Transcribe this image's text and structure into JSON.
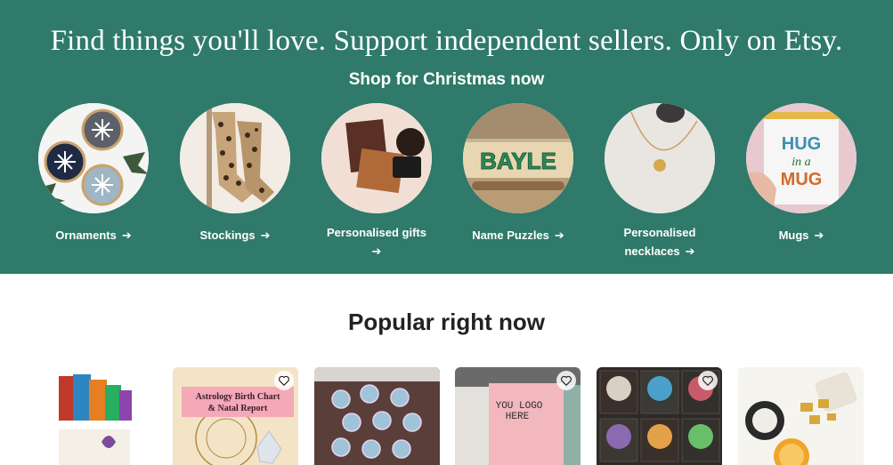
{
  "hero": {
    "title": "Find things you'll love. Support independent sellers. Only on Etsy.",
    "subtitle": "Shop for Christmas now",
    "background_color": "#2f7a6a",
    "categories": [
      {
        "label": "Ornaments",
        "image": "embroidered snowflake hoop ornaments"
      },
      {
        "label": "Stockings",
        "image": "leopard print stockings"
      },
      {
        "label": "Personalised gifts",
        "image": "leather notebook and coaster"
      },
      {
        "label": "Name Puzzles",
        "image": "wooden name puzzle BAYLE",
        "puzzle_text": "BAYLE"
      },
      {
        "label": "Personalised necklaces",
        "image": "gold initial necklace"
      },
      {
        "label": "Mugs",
        "image": "HUG in a MUG mug",
        "mug_text_1": "HUG",
        "mug_text_2": "in a",
        "mug_text_3": "MUG"
      }
    ]
  },
  "popular": {
    "title": "Popular right now",
    "items": [
      {
        "image": "snack gift box"
      },
      {
        "image": "astrology birth chart report",
        "banner_line_1": "Astrology Birth Chart",
        "banner_line_2": "& Natal Report"
      },
      {
        "image": "iridescent moon crystals"
      },
      {
        "image": "custom logo tote bag",
        "bag_line_1": "YOU LOGO",
        "bag_line_2": "HERE"
      },
      {
        "image": "gemstone bonsai trees"
      },
      {
        "image": "golden soap and dried orange"
      }
    ]
  }
}
